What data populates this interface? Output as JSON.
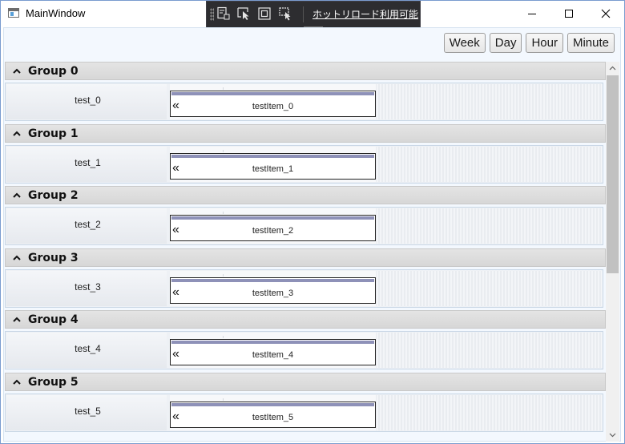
{
  "window": {
    "title": "MainWindow"
  },
  "devtoolbar": {
    "hot_reload": "ホットリロード利用可能",
    "collapse": "‹"
  },
  "zoom_buttons": [
    "Week",
    "Day",
    "Hour",
    "Minute"
  ],
  "groups": [
    {
      "title": "Group 0",
      "row_label": "test_0",
      "item_label": "testItem_0"
    },
    {
      "title": "Group 1",
      "row_label": "test_1",
      "item_label": "testItem_1"
    },
    {
      "title": "Group 2",
      "row_label": "test_2",
      "item_label": "testItem_2"
    },
    {
      "title": "Group 3",
      "row_label": "test_3",
      "item_label": "testItem_3"
    },
    {
      "title": "Group 4",
      "row_label": "test_4",
      "item_label": "testItem_4"
    },
    {
      "title": "Group 5",
      "row_label": "test_5",
      "item_label": "testItem_5"
    }
  ],
  "item_arrow": "«",
  "icons": {
    "app": "window-app-icon",
    "minimize": "minimize-icon",
    "maximize": "maximize-icon",
    "close": "close-icon",
    "dev_tools": [
      "live-visual-tree-icon",
      "select-element-icon",
      "display-layout-adorners-icon",
      "track-focus-icon"
    ],
    "group_toggle": "chevron-up-icon"
  },
  "colors": {
    "item_strip": "#8e91b8",
    "client_bg": "#f3f8fe",
    "devbar_bg": "#2d2d30"
  }
}
